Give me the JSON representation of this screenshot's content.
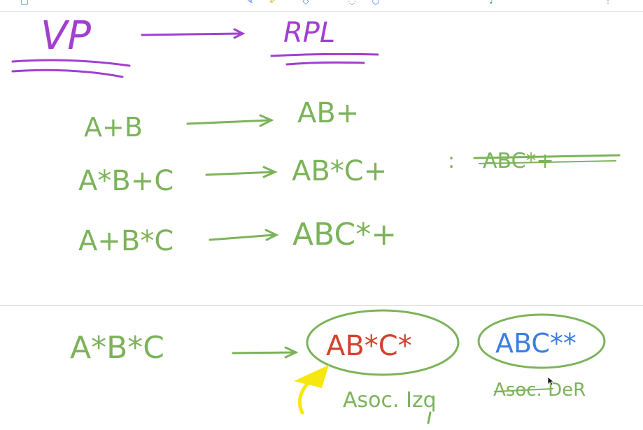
{
  "colors": {
    "purple": "#a13fcf",
    "green": "#7cb35a",
    "red": "#d2412d",
    "blue": "#3a7ee0",
    "yellow": "#f6e80f",
    "divider": "#cfcfcf",
    "toolbar_accent": "#3a7bd5"
  },
  "toolbar": {
    "icons": [
      "tab-icon",
      "pen-icon",
      "highlighter-icon",
      "eraser-icon",
      "lasso-icon",
      "shapes-icon",
      "mic-icon",
      "more-icon"
    ]
  },
  "ink": {
    "heading_left": "VP",
    "heading_right": "RPL",
    "rows": [
      {
        "infix": "A+B",
        "postfix": "AB+"
      },
      {
        "infix": "A*B+C",
        "postfix": "AB*C+",
        "separator": ":",
        "struck": "ABC*+"
      },
      {
        "infix": "A+B*C",
        "postfix": "ABC*+"
      }
    ],
    "bottom": {
      "infix": "A*B*C",
      "left_assoc": "AB*C*",
      "right_assoc": "ABC**",
      "left_label": "Asoc. Izq",
      "right_label": "Asoc. DeR"
    }
  }
}
